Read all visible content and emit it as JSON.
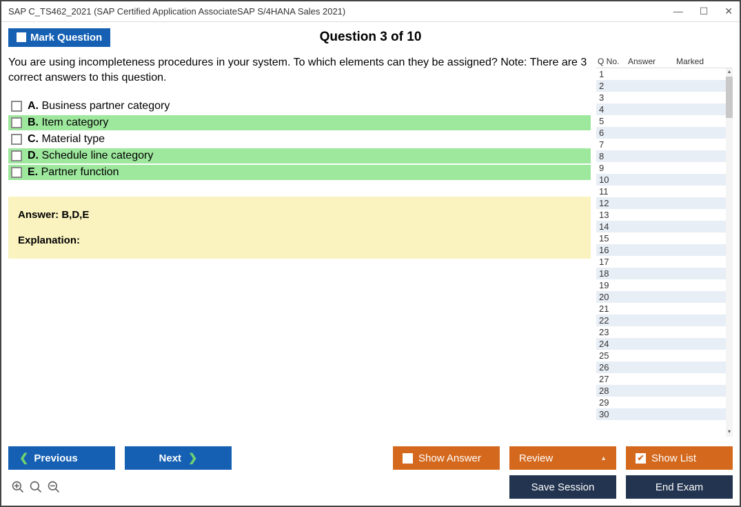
{
  "titlebar": {
    "title": "SAP C_TS462_2021 (SAP Certified Application AssociateSAP S/4HANA Sales 2021)"
  },
  "header": {
    "mark_label": "Mark Question",
    "question_title": "Question 3 of 10"
  },
  "question": {
    "text": "You are using incompleteness procedures in your system. To which elements can they be assigned? Note: There are 3 correct answers to this question.",
    "choices": [
      {
        "letter": "A.",
        "text": "Business partner category",
        "correct": false
      },
      {
        "letter": "B.",
        "text": "Item category",
        "correct": true
      },
      {
        "letter": "C.",
        "text": "Material type",
        "correct": false
      },
      {
        "letter": "D.",
        "text": "Schedule line category",
        "correct": true
      },
      {
        "letter": "E.",
        "text": "Partner function",
        "correct": true
      }
    ]
  },
  "answer_panel": {
    "answer_label": "Answer: B,D,E",
    "explanation_label": "Explanation:"
  },
  "sidebar": {
    "headers": {
      "qno": "Q No.",
      "answer": "Answer",
      "marked": "Marked"
    },
    "rows": [
      1,
      2,
      3,
      4,
      5,
      6,
      7,
      8,
      9,
      10,
      11,
      12,
      13,
      14,
      15,
      16,
      17,
      18,
      19,
      20,
      21,
      22,
      23,
      24,
      25,
      26,
      27,
      28,
      29,
      30
    ]
  },
  "footer": {
    "previous": "Previous",
    "next": "Next",
    "show_answer": "Show Answer",
    "review": "Review",
    "show_list": "Show List",
    "save_session": "Save Session",
    "end_exam": "End Exam"
  }
}
